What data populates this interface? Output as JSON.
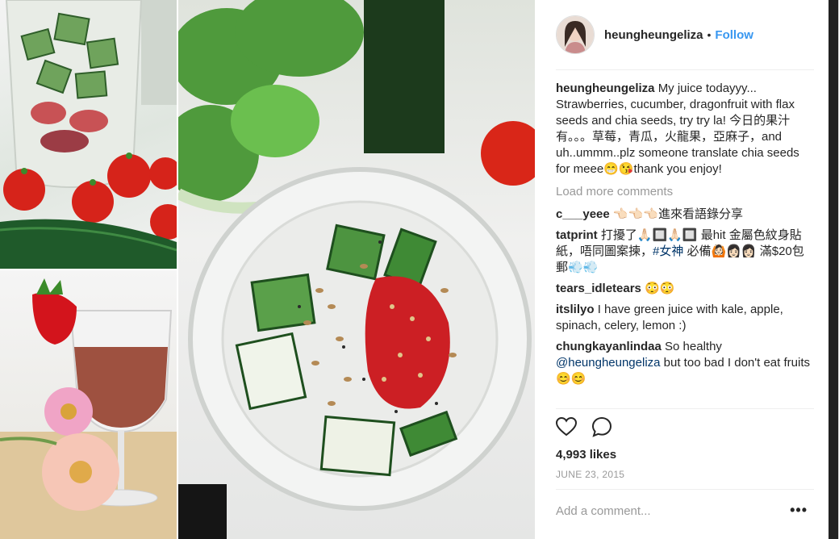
{
  "post": {
    "username": "heungheungeliza",
    "separator": "•",
    "follow_label": "Follow",
    "caption": {
      "user": "heungheungeliza",
      "text": "My juice todayyy... Strawberries, cucumber, dragonfruit with flax seeds and chia seeds, try try la! 今日的果汁有。。。草莓，青瓜，火龍果，亞麻子，and uh..ummm..plz someone translate chia seeds for meee😁😘thank you enjoy!"
    },
    "load_more_label": "Load more comments",
    "comments": [
      {
        "user": "c___yeee",
        "text": "👈🏻👈🏻👈🏻進來看語錄分享"
      },
      {
        "user": "tatprint",
        "text_a": "打擾了🙏🏻🔲🙏🏻🔲 最hit 金屬色紋身貼紙，唔同圖案揀，",
        "tag": "#女神",
        "text_b": " 必備🙆🏻👩🏻👩🏻 滿$20包郵💨💨"
      },
      {
        "user": "tears_idletears",
        "text": "😳😳"
      },
      {
        "user": "itslilyo",
        "text": "I have green juice with kale, apple, spinach, celery, lemon :)"
      },
      {
        "user": "chungkayanlindaa",
        "text_a": "So healthy ",
        "mention": "@heungheungeliza",
        "text_b": " but too bad I don't eat fruits 😊😊"
      }
    ],
    "likes": "4,993 likes",
    "date": "JUNE 23, 2015",
    "add_comment_placeholder": "Add a comment...",
    "more_label": "•••"
  },
  "colors": {
    "follow": "#3897f0",
    "text": "#262626",
    "muted": "#999999",
    "border": "#efefef"
  },
  "icons": [
    "heart-icon",
    "comment-icon",
    "more-options-icon"
  ]
}
